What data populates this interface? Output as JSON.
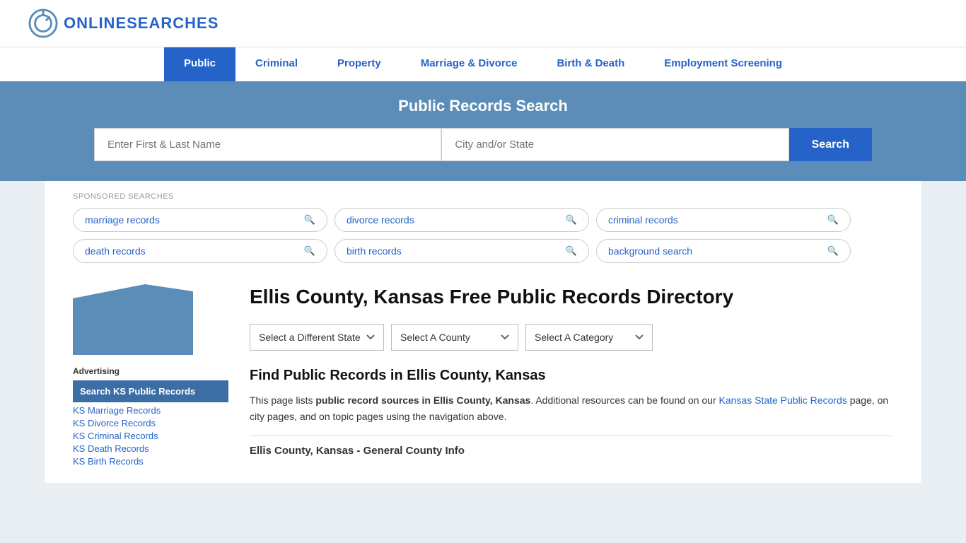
{
  "header": {
    "logo_text_plain": "ONLINE",
    "logo_text_highlight": "SEARCHES"
  },
  "nav": {
    "items": [
      {
        "label": "Public",
        "active": true
      },
      {
        "label": "Criminal",
        "active": false
      },
      {
        "label": "Property",
        "active": false
      },
      {
        "label": "Marriage & Divorce",
        "active": false
      },
      {
        "label": "Birth & Death",
        "active": false
      },
      {
        "label": "Employment Screening",
        "active": false
      }
    ]
  },
  "search_banner": {
    "title": "Public Records Search",
    "name_placeholder": "Enter First & Last Name",
    "location_placeholder": "City and/or State",
    "button_label": "Search"
  },
  "sponsored": {
    "label": "SPONSORED SEARCHES",
    "pills": [
      {
        "label": "marriage records"
      },
      {
        "label": "divorce records"
      },
      {
        "label": "criminal records"
      },
      {
        "label": "death records"
      },
      {
        "label": "birth records"
      },
      {
        "label": "background search"
      }
    ]
  },
  "page": {
    "title": "Ellis County, Kansas Free Public Records Directory",
    "dropdowns": {
      "state_label": "Select a Different State",
      "county_label": "Select A County",
      "category_label": "Select A Category"
    },
    "find_title": "Find Public Records in Ellis County, Kansas",
    "description_part1": "This page lists ",
    "description_bold": "public record sources in Ellis County, Kansas",
    "description_part2": ". Additional resources can be found on our ",
    "description_link_text": "Kansas State Public Records",
    "description_link_href": "#",
    "description_part3": " page, on city pages, and on topic pages using the navigation above.",
    "general_info_title": "Ellis County, Kansas - General County Info"
  },
  "sidebar": {
    "advertising_label": "Advertising",
    "ad_highlighted": "Search KS Public Records",
    "ad_links": [
      "KS Marriage Records",
      "KS Divorce Records",
      "KS Criminal Records",
      "KS Death Records",
      "KS Birth Records"
    ]
  }
}
